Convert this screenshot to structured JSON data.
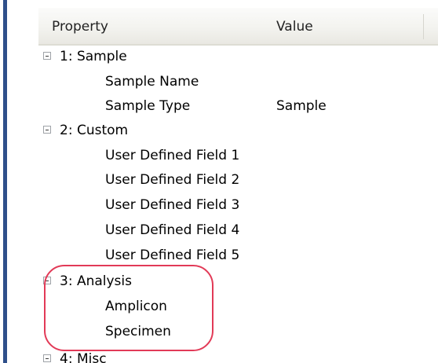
{
  "header": {
    "property": "Property",
    "value": "Value"
  },
  "groups": [
    {
      "label": "1: Sample",
      "children": [
        {
          "label": "Sample Name",
          "value": ""
        },
        {
          "label": "Sample Type",
          "value": "Sample"
        }
      ]
    },
    {
      "label": "2: Custom",
      "children": [
        {
          "label": "User Defined Field 1",
          "value": ""
        },
        {
          "label": "User Defined Field 2",
          "value": ""
        },
        {
          "label": "User Defined Field 3",
          "value": ""
        },
        {
          "label": "User Defined Field 4",
          "value": ""
        },
        {
          "label": "User Defined Field 5",
          "value": ""
        }
      ]
    },
    {
      "label": "3: Analysis",
      "children": [
        {
          "label": "Amplicon",
          "value": ""
        },
        {
          "label": "Specimen",
          "value": ""
        }
      ]
    },
    {
      "label": "4: Misc",
      "children": []
    }
  ],
  "colors": {
    "highlight": "#e23a57",
    "left_bar": "#2f4f8a",
    "header_bg": "#f3f3ef"
  }
}
